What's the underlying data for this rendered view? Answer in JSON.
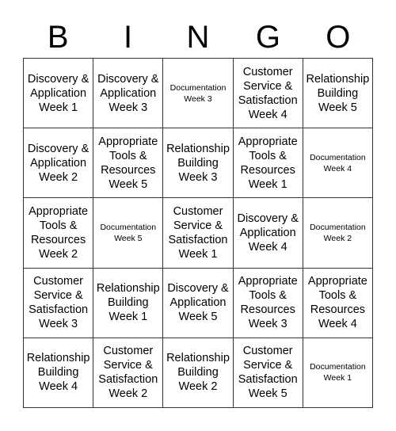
{
  "header": [
    "B",
    "I",
    "N",
    "G",
    "O"
  ],
  "cells": [
    [
      "Discovery & Application Week 1",
      "Discovery & Application Week 3",
      "Documentation Week 3",
      "Customer Service & Satisfaction Week 4",
      "Relationship Building Week 5"
    ],
    [
      "Discovery & Application Week 2",
      "Appropriate Tools & Resources Week 5",
      "Relationship Building Week 3",
      "Appropriate Tools & Resources Week 1",
      "Documentation Week 4"
    ],
    [
      "Appropriate Tools & Resources Week 2",
      "Documentation Week 5",
      "Customer Service & Satisfaction Week 1",
      "Discovery & Application Week 4",
      "Documentation Week 2"
    ],
    [
      "Customer Service & Satisfaction Week 3",
      "Relationship Building Week 1",
      "Discovery & Application Week 5",
      "Appropriate Tools & Resources Week 3",
      "Appropriate Tools & Resources Week 4"
    ],
    [
      "Relationship Building Week 4",
      "Customer Service & Satisfaction Week 2",
      "Relationship Building Week 2",
      "Customer Service & Satisfaction Week 5",
      "Documentation Week 1"
    ]
  ]
}
